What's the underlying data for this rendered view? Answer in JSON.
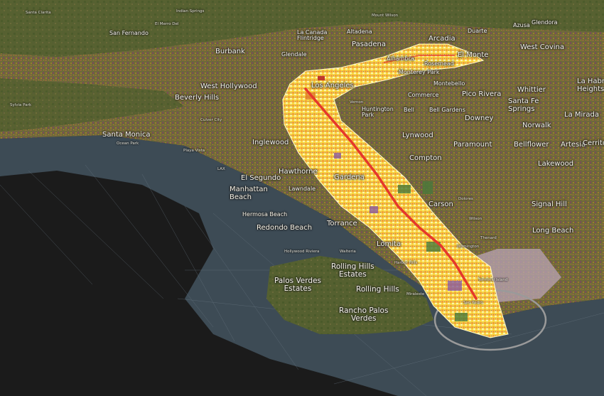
{
  "map": {
    "colors": {
      "ocean": "#3d4b55",
      "void": "#1b1b1b",
      "land": "#6e6a3a",
      "land_dark": "#4d5a2e",
      "corridor_hot": "#f7d33a",
      "corridor_pale": "#fdf0a8",
      "corridor_orange": "#f09a2a",
      "route": "#e5382b",
      "port_ring": "#9a9a9a"
    },
    "labels": {
      "santa_clarita": "Santa Clarita",
      "indian_springs": "Indian Springs",
      "mount_wilson": "Mount Wilson",
      "san_fernando": "San Fernando",
      "el_merro_del": "El Merro Del",
      "la_canada_flintridge": "La Canada\nFlintridge",
      "altadena": "Altadena",
      "arcadia": "Arcadia",
      "duarte": "Duarte",
      "azusa": "Azusa",
      "glendora": "Glendora",
      "burbank": "Burbank",
      "glendale": "Glendale",
      "pasadena": "Pasadena",
      "west_covina": "West Covina",
      "el_monte": "El Monte",
      "alhambra": "Alhambra",
      "rosemead": "Rosemead",
      "monterey_park": "Monterey Park",
      "west_hollywood": "West Hollywood",
      "los_angeles": "Los Angeles",
      "beverly_hills": "Beverly Hills",
      "montebello": "Montebello",
      "commerce": "Commerce",
      "pico_rivera": "Pico Rivera",
      "whittier": "Whittier",
      "la_habra_heights": "La Habra\nHeights",
      "vernon": "Vernon",
      "huntington_park": "Huntington\nPark",
      "bell": "Bell",
      "bell_gardens": "Bell Gardens",
      "santa_fe_springs": "Santa Fe\nSprings",
      "downey": "Downey",
      "la_mirada": "La Mirada",
      "santa_monica": "Santa Monica",
      "lynwood": "Lynwood",
      "norwalk": "Norwalk",
      "inglewood": "Inglewood",
      "paramount": "Paramount",
      "bellflower": "Bellflower",
      "artesia": "Artesia",
      "cerritos": "Cerritos",
      "compton": "Compton",
      "el_segundo": "El Segundo",
      "hawthorne": "Hawthorne",
      "gardena": "Gardena",
      "lakewood": "Lakewood",
      "manhattan_beach": "Manhattan\nBeach",
      "lawndale": "Lawndale",
      "carson": "Carson",
      "signal_hill": "Signal Hill",
      "hermosa_beach": "Hermosa Beach",
      "torrance": "Torrance",
      "long_beach": "Long Beach",
      "redondo_beach": "Redondo Beach",
      "lomita": "Lomita",
      "wilmington": "Wilmington",
      "rolling_hills_estates": "Rolling Hills\nEstates",
      "palos_verdes_estates": "Palos Verdes\nEstates",
      "rolling_hills": "Rolling Hills",
      "terminal_island": "Terminal Island",
      "san_pedro": "San Pedro",
      "rancho_palos_verdes": "Rancho Palos\nVerdes",
      "lax": "LAX",
      "ocean_park": "Ocean Park",
      "playa_vista": "Playa Vista",
      "culver_city": "Culver City",
      "sylvia_park": "Sylvia Park",
      "walteria": "Walteria",
      "harbor_hills": "Harbor Hills",
      "miraleste": "Miraleste",
      "hollywood_riviera": "Hollywood Riviera",
      "dolores": "Dolores",
      "wilson": "Wilson",
      "thenard": "Thenard"
    }
  }
}
